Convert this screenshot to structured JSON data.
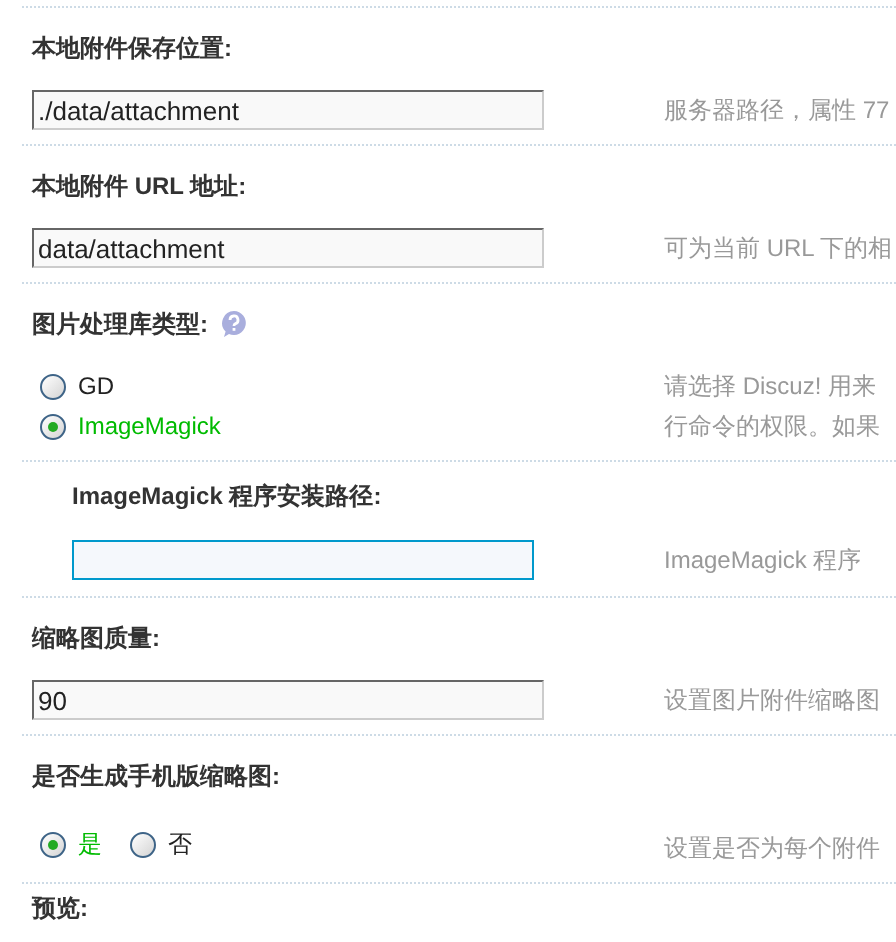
{
  "sections": [
    {
      "kind": "text",
      "label": "本地附件保存位置:",
      "value": "./data/attachment",
      "focused": false,
      "hint": [
        "服务器路径，属性 77"
      ]
    },
    {
      "kind": "text",
      "label": "本地附件 URL 地址:",
      "value": "data/attachment",
      "focused": false,
      "hint": [
        "可为当前 URL 下的相"
      ]
    },
    {
      "kind": "radio",
      "label": "图片处理库类型:",
      "help": true,
      "options": [
        {
          "label": "GD",
          "selected": false
        },
        {
          "label": "ImageMagick",
          "selected": true
        }
      ],
      "hint": [
        "请选择 Discuz! 用来",
        "行命令的权限。如果"
      ],
      "children": [
        {
          "kind": "text",
          "label": "ImageMagick 程序安装路径:",
          "focused": true,
          "hint": [
            "ImageMagick 程序"
          ]
        }
      ]
    },
    {
      "kind": "text",
      "label": "缩略图质量:",
      "value": "90",
      "focused": false,
      "hint": [
        "设置图片附件缩略图"
      ]
    },
    {
      "kind": "radio-inline",
      "label": "是否生成手机版缩略图:",
      "options": [
        {
          "label": "是",
          "selected": true
        },
        {
          "label": "否",
          "selected": false
        }
      ],
      "hint": [
        "设置是否为每个附件"
      ]
    },
    {
      "kind": "heading",
      "label": "预览:"
    }
  ]
}
